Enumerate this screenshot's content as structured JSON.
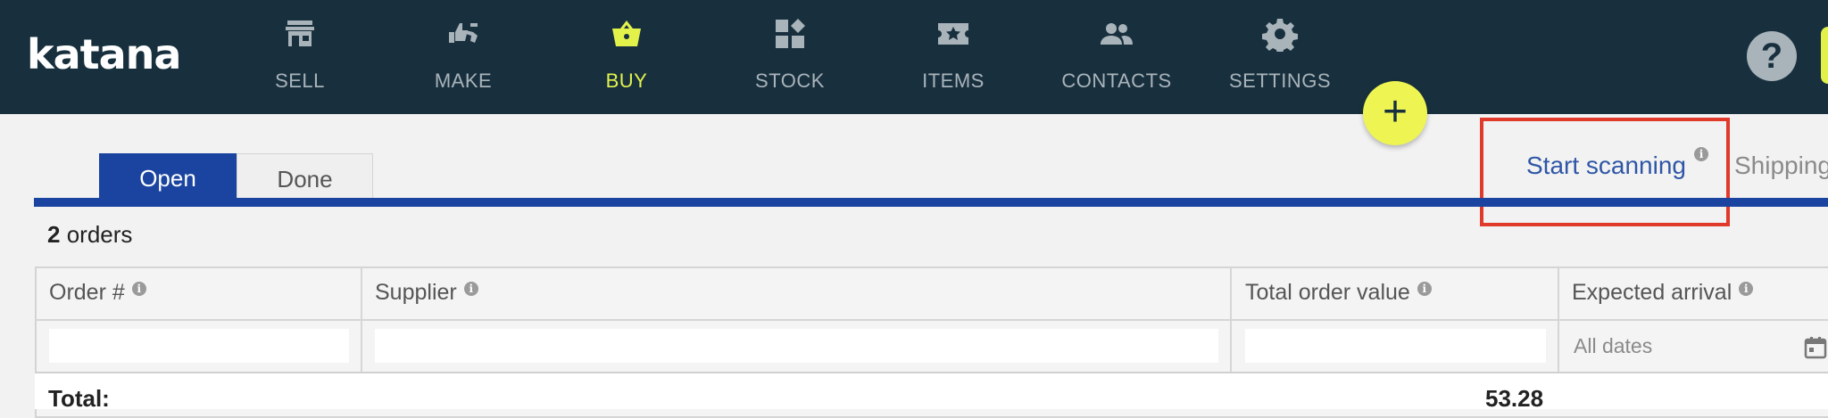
{
  "brand": {
    "logo_text": "katana",
    "accent": "#e3f24b",
    "nav_bg": "#18303e",
    "primary_blue": "#1a44a0"
  },
  "nav": {
    "items": [
      {
        "label": "SELL",
        "icon": "store-icon"
      },
      {
        "label": "MAKE",
        "icon": "thumbs-icon"
      },
      {
        "label": "BUY",
        "icon": "basket-icon",
        "active": true
      },
      {
        "label": "STOCK",
        "icon": "blocks-icon"
      },
      {
        "label": "ITEMS",
        "icon": "ticket-star-icon"
      },
      {
        "label": "CONTACTS",
        "icon": "people-icon"
      },
      {
        "label": "SETTINGS",
        "icon": "gear-icon"
      }
    ],
    "help": "?",
    "fab": "+"
  },
  "tabs": {
    "open": "Open",
    "done": "Done"
  },
  "actions": {
    "start_scanning": "Start scanning",
    "shipping": "Shipping",
    "info_glyph": "i"
  },
  "summary": {
    "count": "2",
    "noun": "orders"
  },
  "table": {
    "columns": {
      "order": "Order #",
      "supplier": "Supplier",
      "total_value": "Total order value",
      "expected_arrival": "Expected arrival"
    },
    "filters": {
      "expected_arrival_placeholder": "All dates"
    },
    "total_label": "Total:",
    "total_value": "53.28"
  }
}
